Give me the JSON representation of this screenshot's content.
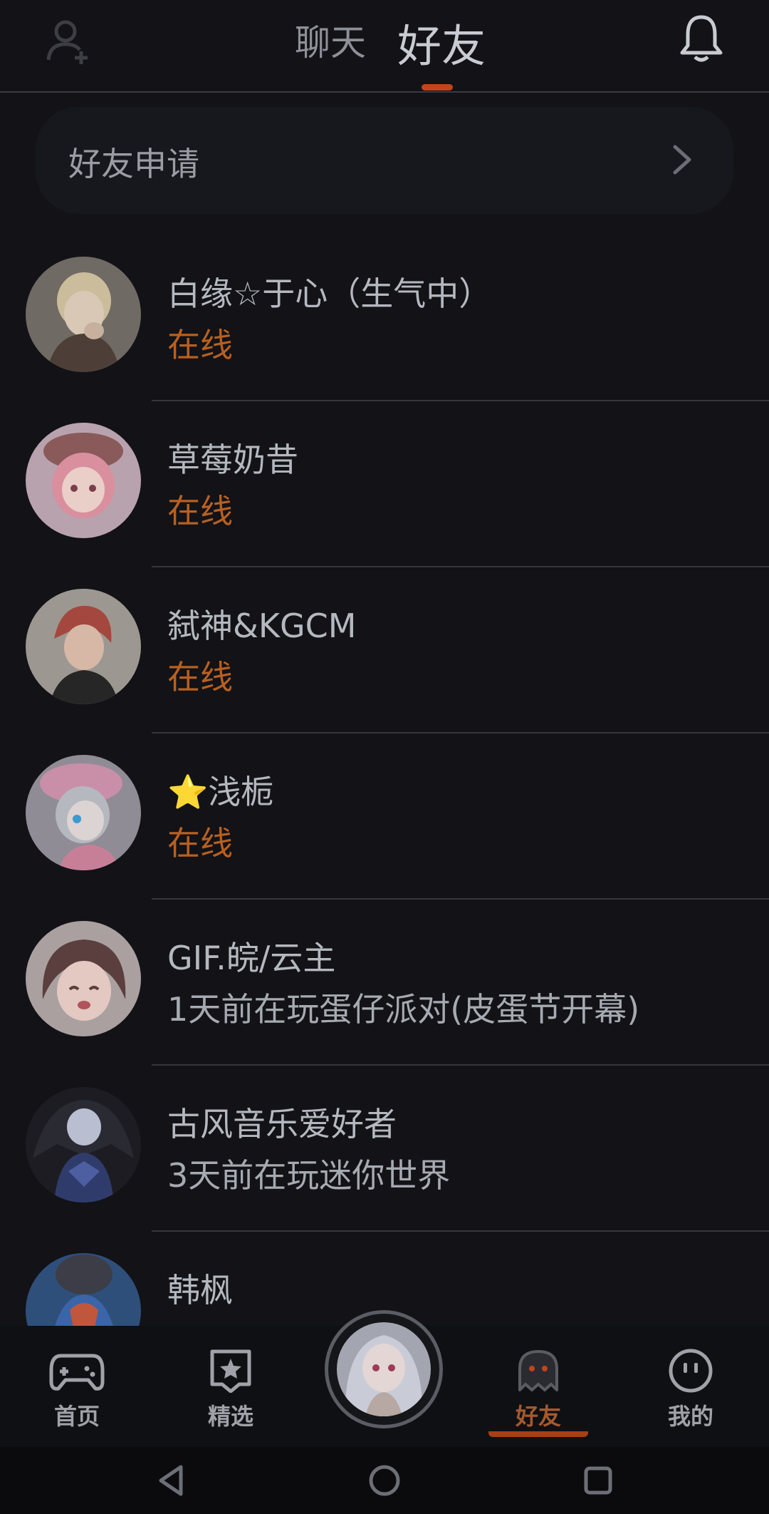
{
  "header": {
    "tab_chat": "聊天",
    "tab_friends": "好友",
    "active_tab": "好友"
  },
  "friend_request": {
    "label": "好友申请"
  },
  "friends": [
    {
      "name": "白缘☆于心（生气中）",
      "status": "在线",
      "online": true
    },
    {
      "name": "草莓奶昔",
      "status": "在线",
      "online": true
    },
    {
      "name": "弑神&KGCM",
      "status": "在线",
      "online": true
    },
    {
      "name": "⭐浅栀",
      "status": "在线",
      "online": true
    },
    {
      "name": "GIF.皖/云主",
      "status": "1天前在玩蛋仔派对(皮蛋节开幕)",
      "online": false
    },
    {
      "name": "古风音乐爱好者",
      "status": "3天前在玩迷你世界",
      "online": false
    },
    {
      "name": "韩枫",
      "status": "",
      "online": false
    }
  ],
  "bottom_nav": {
    "home": "首页",
    "featured": "精选",
    "friends": "好友",
    "mine": "我的",
    "active": "好友"
  },
  "colors": {
    "background": "#121217",
    "accent": "#c5431b",
    "online_status": "#b8601f"
  },
  "icons": {
    "add_friend": "person-plus-icon",
    "bell": "bell-icon",
    "chevron": "chevron-right-icon",
    "home": "gamepad-icon",
    "featured": "star-badge-icon",
    "friends": "ghost-icon",
    "mine": "smiley-icon",
    "back": "triangle-back-icon",
    "home_sys": "circle-home-icon",
    "recents": "square-recents-icon"
  }
}
